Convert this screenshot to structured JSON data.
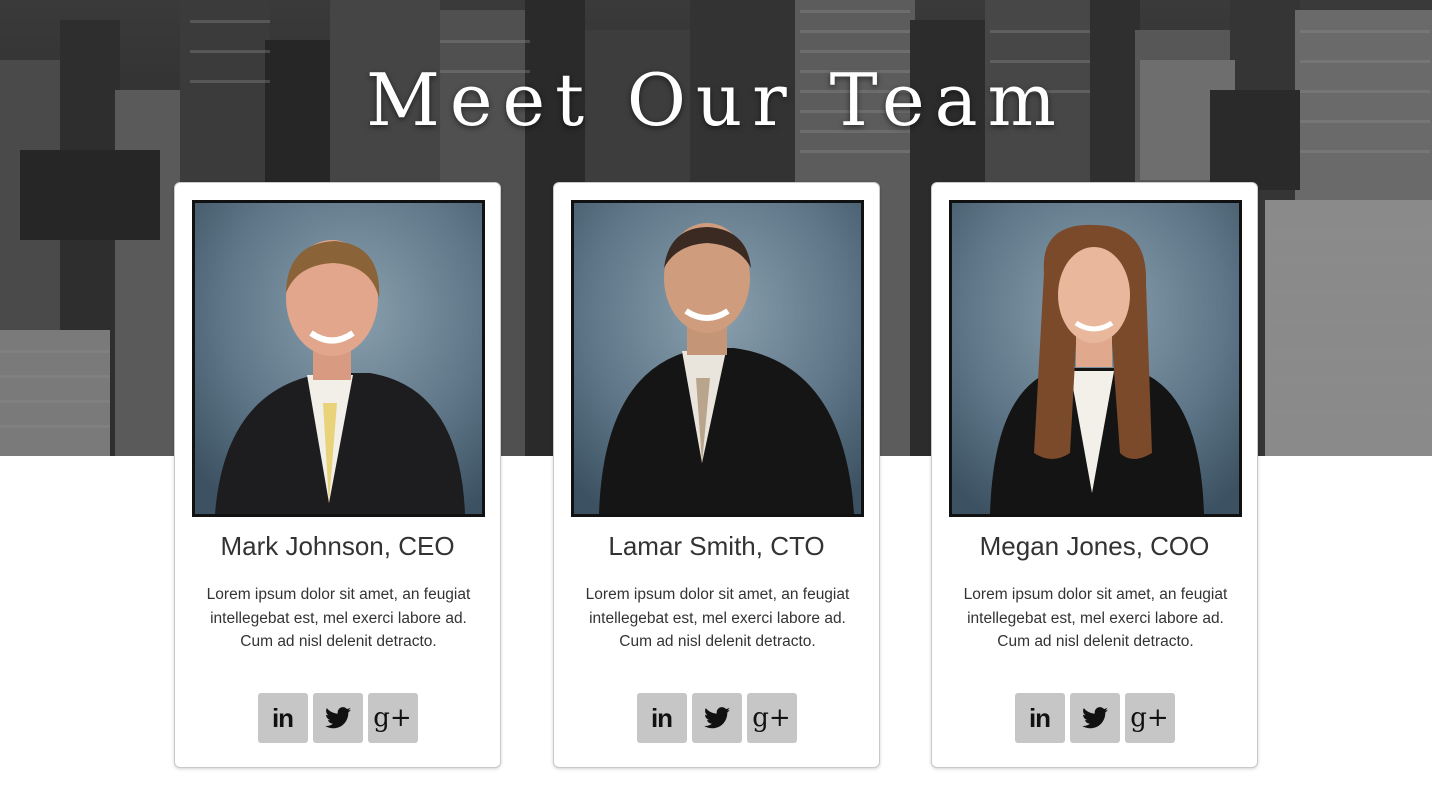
{
  "hero": {
    "title": "Meet Our Team"
  },
  "team": [
    {
      "name": "Mark Johnson, CEO",
      "bio": "Lorem ipsum dolor sit amet, an feugiat intellegebat est, mel exerci labore ad. Cum ad nisl delenit detracto.",
      "social": {
        "linkedin": "in",
        "twitter": "twitter-icon",
        "googleplus": "g+"
      }
    },
    {
      "name": "Lamar Smith, CTO",
      "bio": "Lorem ipsum dolor sit amet, an feugiat intellegebat est, mel exerci labore ad. Cum ad nisl delenit detracto.",
      "social": {
        "linkedin": "in",
        "twitter": "twitter-icon",
        "googleplus": "g+"
      }
    },
    {
      "name": "Megan Jones, COO",
      "bio": "Lorem ipsum dolor sit amet, an feugiat intellegebat est, mel exerci labore ad. Cum ad nisl delenit detracto.",
      "social": {
        "linkedin": "in",
        "twitter": "twitter-icon",
        "googleplus": "g+"
      }
    }
  ],
  "colors": {
    "social_button_bg": "#c6c6c6",
    "photo_background": "#5e7688"
  }
}
